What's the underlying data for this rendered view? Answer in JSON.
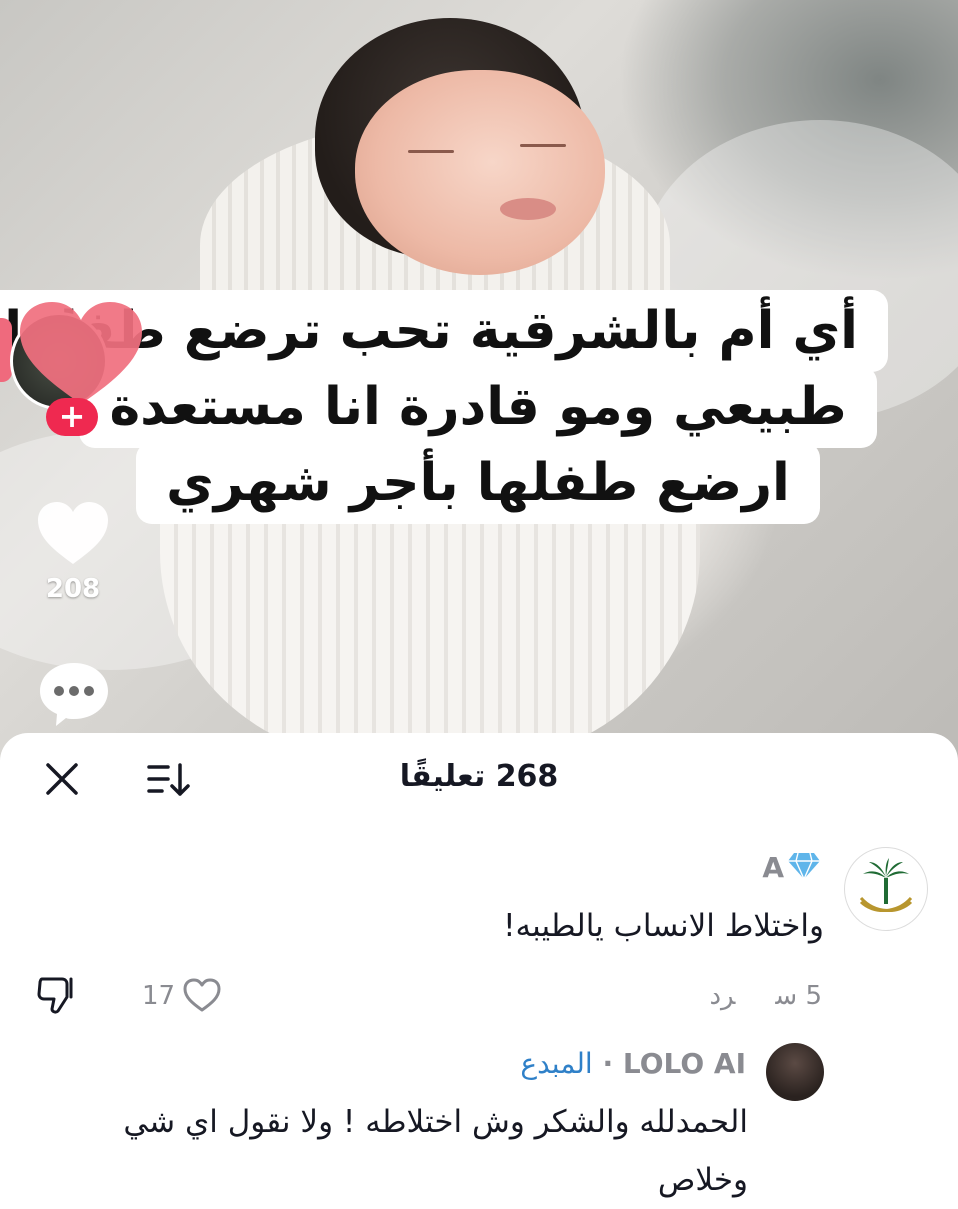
{
  "video": {
    "caption_lines": [
      "أي أم بالشرقية تحب ترضع طفلها",
      "طبيعي ومو قادرة انا مستعدة",
      "ارضع طفلها بأجر شهري"
    ],
    "like_count": "208"
  },
  "comments_sheet": {
    "title": "268 تعليقًا",
    "comments": [
      {
        "username": "A",
        "badge_icon": "diamond-icon",
        "text": "واختلاط الانساب يالطيبه!",
        "time": "5 س",
        "reply_label": "رد",
        "like_count": "17"
      },
      {
        "username": "LOLO AI",
        "separator": " · ",
        "creator_label": "المبدع",
        "text": "الحمدلله والشكر وش اختلاطه ! ولا نقول اي شي وخلاص"
      }
    ]
  },
  "colors": {
    "accent_red": "#ef2950",
    "creator_blue": "#2f80c8",
    "muted_text": "#8a8b91"
  }
}
